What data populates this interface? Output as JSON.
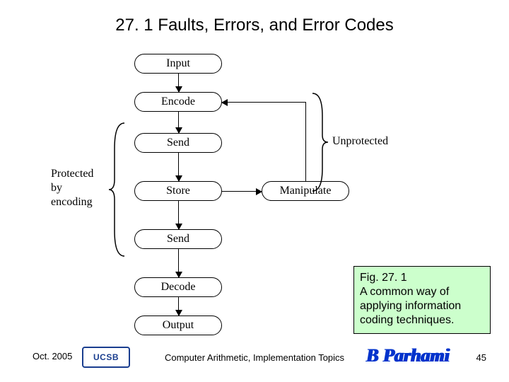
{
  "title": "27. 1  Faults, Errors, and Error Codes",
  "diagram": {
    "nodes": {
      "input": "Input",
      "encode": "Encode",
      "send1": "Send",
      "store": "Store",
      "send2": "Send",
      "decode": "Decode",
      "output": "Output",
      "manipulate": "Manipulate"
    },
    "labels": {
      "protected": "Protected\nby\nencoding",
      "unprotected": "Unprotected"
    }
  },
  "caption": {
    "fig": "Fig. 27. 1",
    "text": "A common way of applying information coding techniques."
  },
  "footer": {
    "date": "Oct. 2005",
    "logo": "UCSB",
    "center": "Computer Arithmetic, Implementation Topics",
    "author": "B Parhami",
    "page": "45"
  }
}
